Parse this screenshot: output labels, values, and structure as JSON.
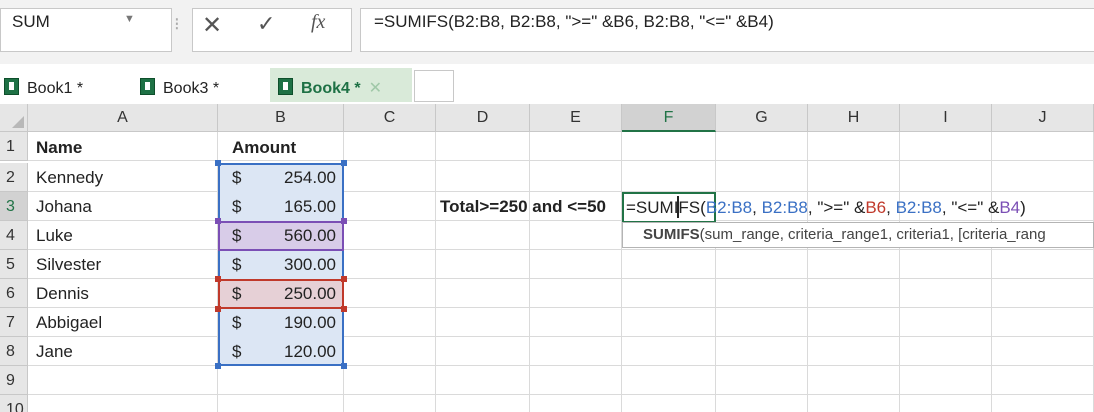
{
  "formula_bar": {
    "name_box": "SUM",
    "cancel_symbol": "✕",
    "enter_symbol": "✓",
    "fx_symbol": "fx",
    "formula": "=SUMIFS(B2:B8, B2:B8, \">=\" &B6, B2:B8, \"<=\" &B4)"
  },
  "tabs": [
    {
      "label": "Book1 *"
    },
    {
      "label": "Book3 *"
    },
    {
      "label": "Book4 *",
      "active": true
    }
  ],
  "columns": [
    "A",
    "B",
    "C",
    "D",
    "E",
    "F",
    "G",
    "H",
    "I",
    "J"
  ],
  "selected_column": "F",
  "rows": [
    "1",
    "2",
    "3",
    "4",
    "5",
    "6",
    "7",
    "8",
    "9",
    "10"
  ],
  "selected_row": "3",
  "headers": {
    "name": "Name",
    "amount": "Amount"
  },
  "records": [
    {
      "name": "Kennedy",
      "currency": "$",
      "amount": "254.00"
    },
    {
      "name": "Johana",
      "currency": "$",
      "amount": "165.00"
    },
    {
      "name": "Luke",
      "currency": "$",
      "amount": "560.00"
    },
    {
      "name": "Silvester",
      "currency": "$",
      "amount": "300.00"
    },
    {
      "name": "Dennis",
      "currency": "$",
      "amount": "250.00"
    },
    {
      "name": "Abbigael",
      "currency": "$",
      "amount": "190.00"
    },
    {
      "name": "Jane",
      "currency": "$",
      "amount": "120.00"
    }
  ],
  "label_d3": "Total>=250 and <=50",
  "cell_edit": {
    "prefix": "=SUMIFS(",
    "r1": "B2:B8",
    "sep1": ", ",
    "r2": "B2:B8",
    "mid": ", \">=\" &",
    "r3": "B6",
    "sep2": ", ",
    "r4": "B2:B8",
    "mid2": ", \"<=\" &",
    "r5": "B4",
    "suffix": ")"
  },
  "tooltip": {
    "fn": "SUMIFS",
    "args": "(sum_range, criteria_range1, criteria1, [criteria_rang"
  },
  "colors": {
    "accent": "#217346",
    "range_blue": "#3a70c4",
    "range_red": "#c0392b",
    "range_purple": "#7b4fb5"
  }
}
